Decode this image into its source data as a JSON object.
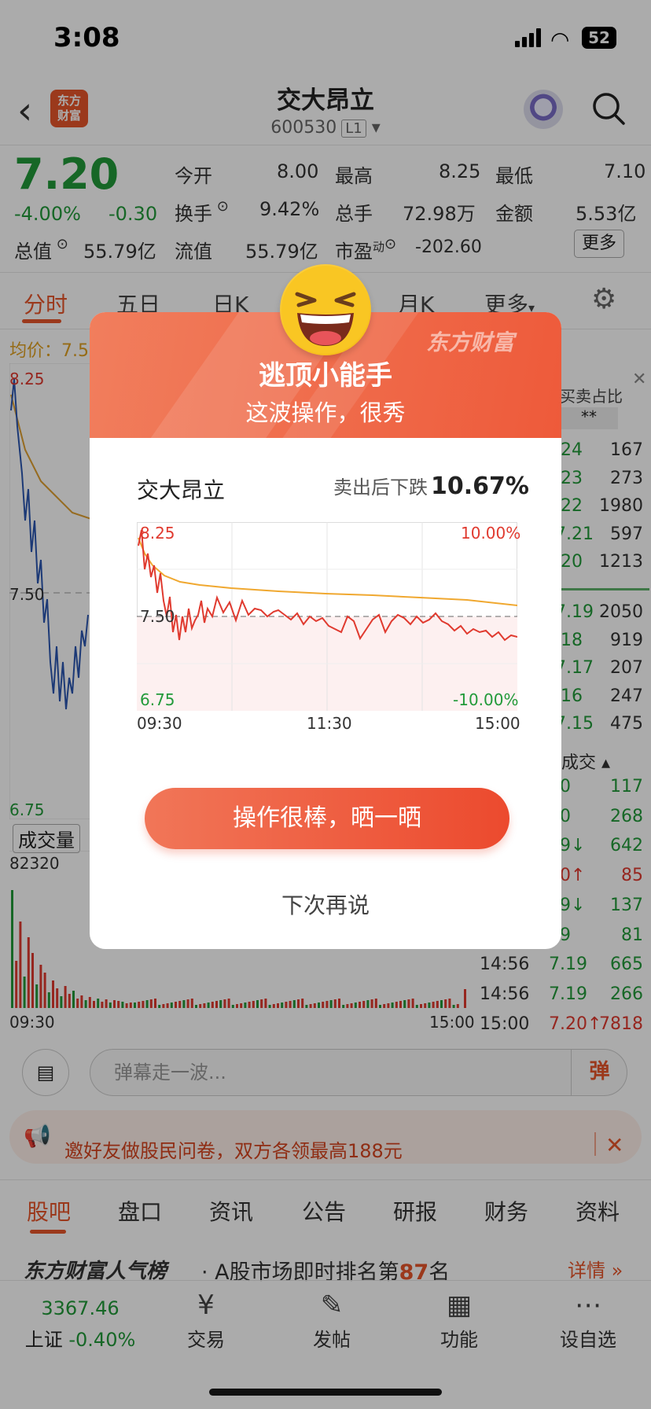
{
  "status_bar": {
    "time": "3:08",
    "battery": "52"
  },
  "header": {
    "back": "‹",
    "logo": "东方\n财富",
    "stock_name": "交大昂立",
    "stock_code": "600530",
    "level": "L1"
  },
  "quote": {
    "price": "7.20",
    "change_pct": "-4.00%",
    "change": "-0.30",
    "fields": [
      {
        "label": "今开",
        "value": "8.00",
        "color": "#e03a2f"
      },
      {
        "label": "最高",
        "value": "8.25",
        "color": "#e03a2f"
      },
      {
        "label": "最低",
        "value": "7.10",
        "color": "#229a3a"
      },
      {
        "label": "换手",
        "value": "9.42%",
        "color": "#333"
      },
      {
        "label": "总手",
        "value": "72.98万",
        "color": "#333"
      },
      {
        "label": "金额",
        "value": "5.53亿",
        "color": "#333"
      },
      {
        "label": "总值",
        "value": "55.79亿",
        "color": "#333"
      },
      {
        "label": "流值",
        "value": "55.79亿",
        "color": "#333"
      },
      {
        "label": "市盈",
        "sup": "动",
        "value": "-202.60",
        "color": "#333"
      }
    ],
    "more_label": "更多"
  },
  "tabs": [
    "分时",
    "五日",
    "日K",
    "周K",
    "月K",
    "更多"
  ],
  "chart_bg": {
    "avg_label": "均价：7.5",
    "high": "8.25",
    "mid": "7.50",
    "low": "6.75",
    "vol_tab": "成交量",
    "vol_max": "82320",
    "t_start": "09:30",
    "t_end": "15:00",
    "side_label": "买卖占比",
    "side_stars": "**"
  },
  "order_book": {
    "sells": [
      {
        "price": ".24",
        "vol": "167"
      },
      {
        "price": ".23",
        "vol": "273"
      },
      {
        "price": ".22",
        "vol": "1980"
      },
      {
        "price": "7.21",
        "vol": "597"
      },
      {
        "price": ".20",
        "vol": "1213"
      }
    ],
    "buys": [
      {
        "price": "7.19",
        "vol": "2050"
      },
      {
        "price": ".18",
        "vol": "919"
      },
      {
        "price": "7.17",
        "vol": "207"
      },
      {
        "price": ".16",
        "vol": "247"
      },
      {
        "price": "7.15",
        "vol": "475"
      }
    ],
    "trades_header": "成交",
    "trades": [
      {
        "time": "",
        "price": "20",
        "vol": "117",
        "color": "#229a3a"
      },
      {
        "time": "",
        "price": "20",
        "vol": "268",
        "color": "#229a3a"
      },
      {
        "time": "",
        "price": "19↓",
        "vol": "642",
        "color": "#229a3a"
      },
      {
        "time": "",
        "price": "20↑",
        "vol": "85",
        "color": "#e03a2f"
      },
      {
        "time": "",
        "price": "19↓",
        "vol": "137",
        "color": "#229a3a"
      },
      {
        "time": "",
        "price": "19",
        "vol": "81",
        "color": "#229a3a"
      },
      {
        "time": "14:56",
        "price": "7.19",
        "vol": "665",
        "color": "#229a3a"
      },
      {
        "time": "14:56",
        "price": "7.19",
        "vol": "266",
        "color": "#229a3a"
      },
      {
        "time": "15:00",
        "price": "7.20↑",
        "vol": "7818",
        "color": "#e03a2f"
      }
    ]
  },
  "danmu": {
    "placeholder": "弹幕走一波...",
    "button": "弹"
  },
  "banner": {
    "text": "邀好友做股民问卷，双方各领最高188元"
  },
  "bottom_tabs": [
    "股吧",
    "盘口",
    "资讯",
    "公告",
    "研报",
    "财务",
    "资料"
  ],
  "rank": {
    "logo": "东方财富人气榜",
    "prefix": "· A股市场即时排名第",
    "num": "87",
    "suffix": "名",
    "more": "详情 »"
  },
  "nav": {
    "index_value": "3367.46",
    "index_name": "上证",
    "index_change": "-0.40%",
    "items": [
      "交易",
      "发帖",
      "功能",
      "设自选"
    ]
  },
  "dialog": {
    "watermark": "东方财富",
    "title": "逃顶小能手",
    "subtitle": "这波操作，很秀",
    "stock": "交大昂立",
    "fall_label": "卖出后下跌",
    "fall_value": "10.67%",
    "chart_high": "8.25",
    "chart_mid": "7.50",
    "chart_low": "6.75",
    "pct_high": "10.00%",
    "pct_low": "-10.00%",
    "t_start": "09:30",
    "t_mid": "11:30",
    "t_end": "15:00",
    "share_button": "操作很棒，晒一晒",
    "later": "下次再说"
  }
}
